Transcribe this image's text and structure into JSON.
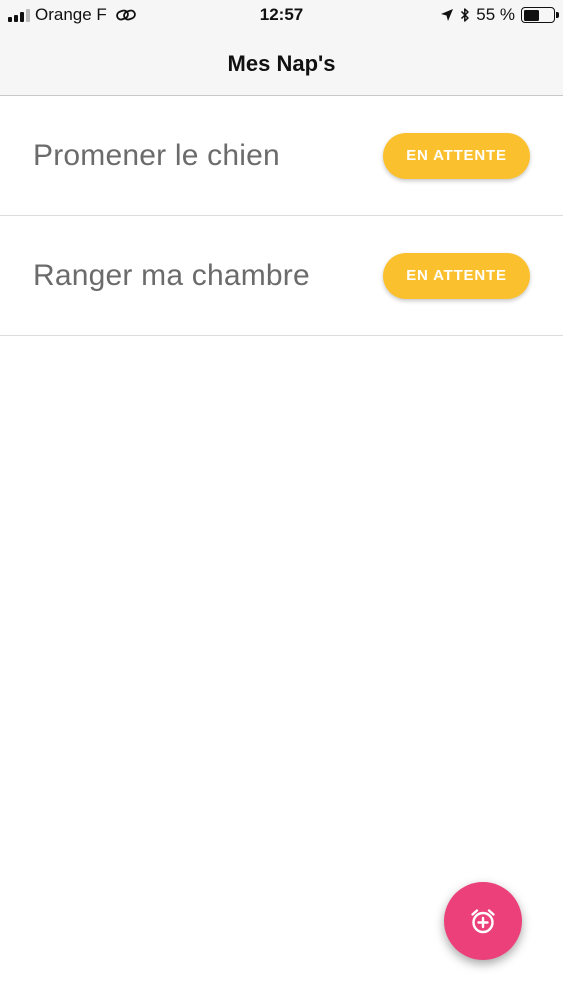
{
  "status_bar": {
    "carrier": "Orange F",
    "time": "12:57",
    "battery_percent": "55 %",
    "battery_level": 0.55,
    "icons": [
      "signal-icon",
      "link-icon",
      "location-arrow-icon",
      "bluetooth-icon",
      "battery-icon"
    ]
  },
  "nav": {
    "title": "Mes Nap's"
  },
  "tasks": [
    {
      "label": "Promener le chien",
      "status": "EN ATTENTE"
    },
    {
      "label": "Ranger ma chambre",
      "status": "EN ATTENTE"
    }
  ],
  "fab": {
    "icon": "alarm-add-icon"
  },
  "colors": {
    "pending": "#fbc02d",
    "fab": "#ec407a",
    "label": "#6b6b6b"
  }
}
